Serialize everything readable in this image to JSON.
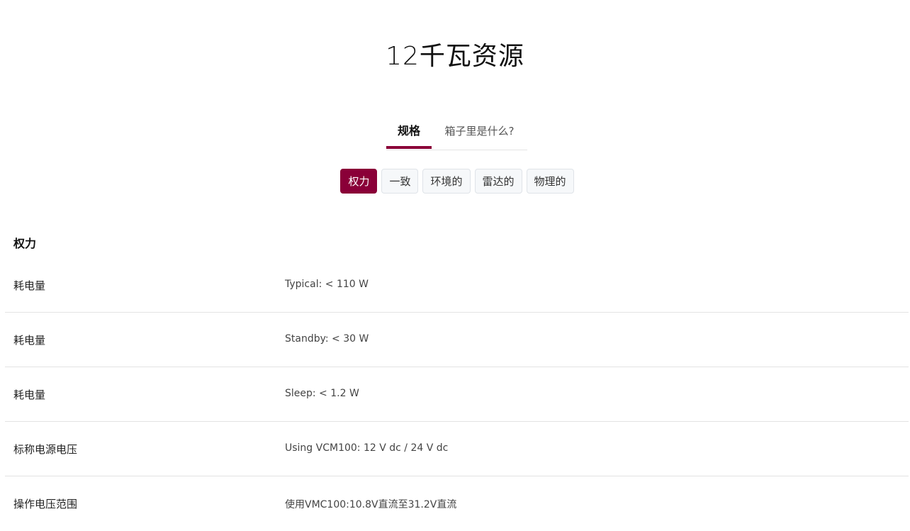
{
  "title": "12千瓦资源",
  "tabs": [
    {
      "label": "规格"
    },
    {
      "label": "箱子里是什么?"
    }
  ],
  "chips": [
    {
      "label": "权力"
    },
    {
      "label": "一致"
    },
    {
      "label": "环境的"
    },
    {
      "label": "雷达的"
    },
    {
      "label": "物理的"
    }
  ],
  "section": {
    "heading": "权力"
  },
  "specs": [
    {
      "label": "耗电量",
      "value": "Typical: < 110 W"
    },
    {
      "label": "耗电量",
      "value": "Standby: < 30 W"
    },
    {
      "label": "耗电量",
      "value": "Sleep: < 1.2 W"
    },
    {
      "label": "标称电源电压",
      "value": "Using VCM100: 12 V dc / 24 V dc"
    },
    {
      "label": "操作电压范围",
      "value": "使用VMC100:10.8V直流至31.2V直流"
    }
  ],
  "colors": {
    "accent": "#8a0038"
  }
}
